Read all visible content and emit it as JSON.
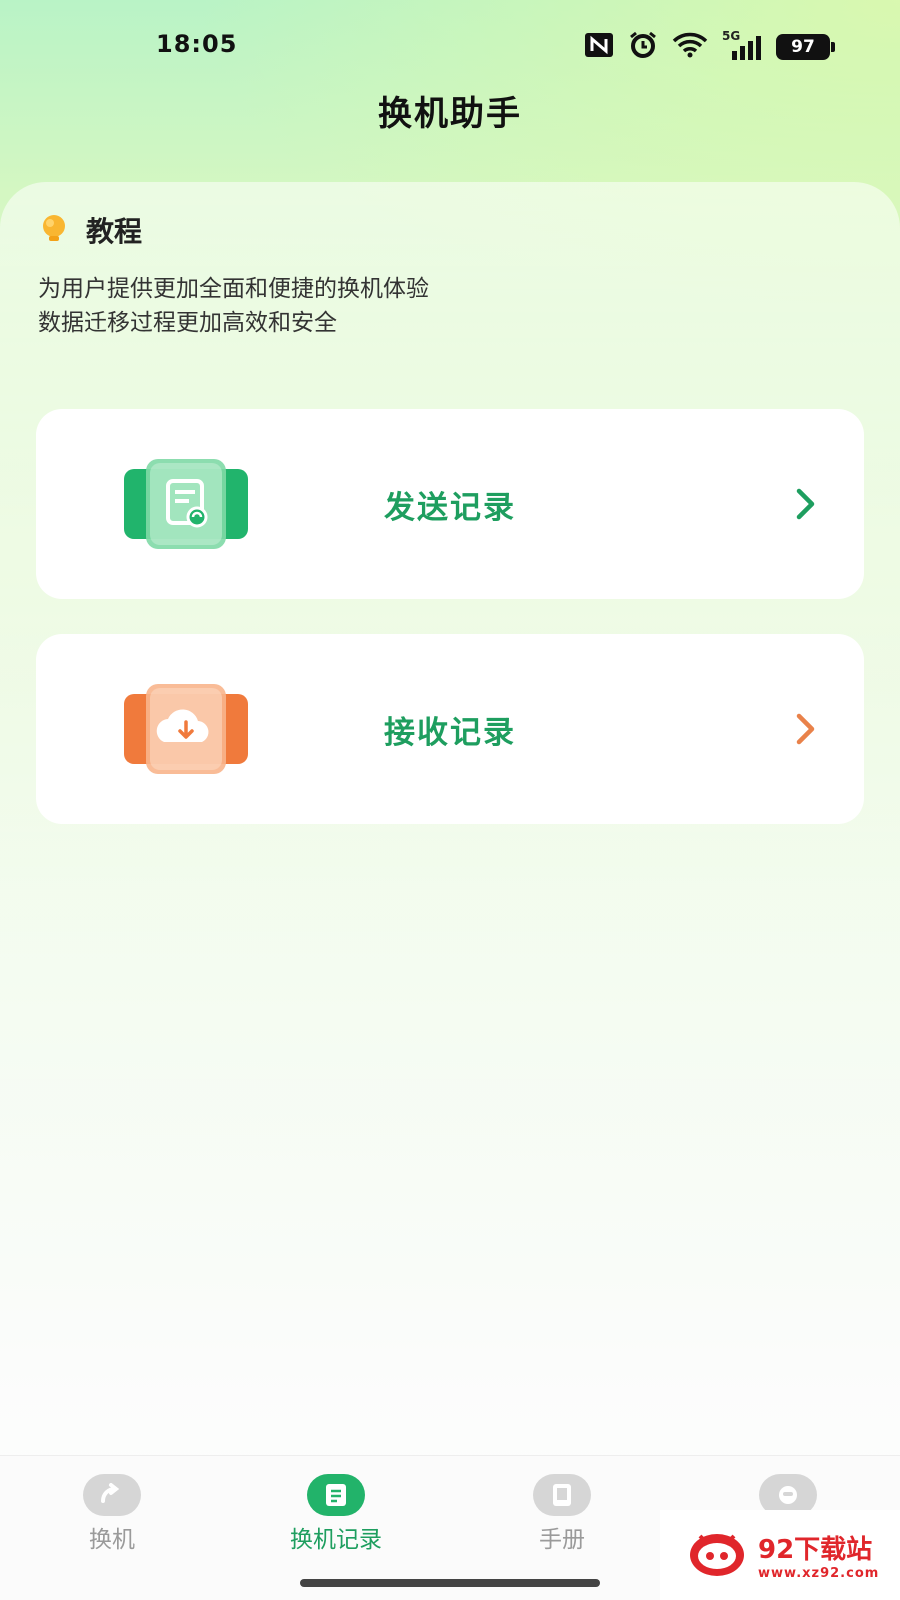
{
  "status_bar": {
    "time": "18:05",
    "network": "5G",
    "battery": "97",
    "icons": [
      "nfc-icon",
      "alarm-icon",
      "wifi-icon",
      "signal-icon",
      "battery-icon"
    ]
  },
  "header": {
    "title": "换机助手"
  },
  "tutorial": {
    "title": "教程",
    "lines": [
      "为用户提供更加全面和便捷的换机体验",
      "数据迁移过程更加高效和安全"
    ]
  },
  "cards": [
    {
      "label": "发送记录",
      "icon": "document-icon",
      "accent": "#21b46c"
    },
    {
      "label": "接收记录",
      "icon": "cloud-download-icon",
      "accent": "#f07a3c"
    }
  ],
  "tabs": [
    {
      "label": "换机",
      "icon": "swap-icon",
      "active": false
    },
    {
      "label": "换机记录",
      "icon": "record-icon",
      "active": true
    },
    {
      "label": "手册",
      "icon": "book-icon",
      "active": false
    },
    {
      "label": "",
      "icon": "profile-icon",
      "active": false
    }
  ],
  "watermark": {
    "name": "92下载站",
    "url": "www.xz92.com"
  },
  "colors": {
    "primary": "#1e9e5f",
    "orange": "#f07a3c",
    "inactive": "#9a9a9a"
  }
}
